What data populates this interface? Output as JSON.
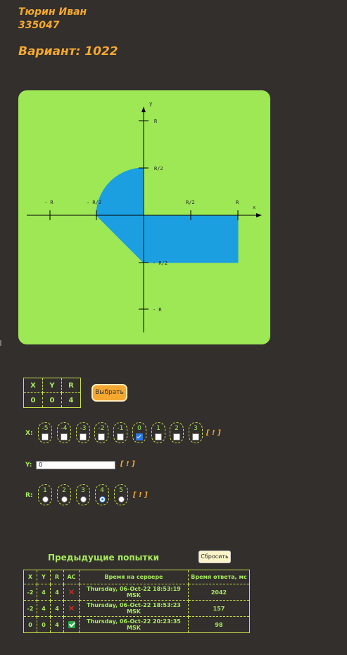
{
  "header": {
    "author": "Тюрин Иван",
    "group": "335047",
    "variant": "Вариант: 1022"
  },
  "graph": {
    "x_axis_label": "x",
    "y_axis_label": "y",
    "x_ticks": [
      "- R",
      "- R/2",
      "R/2",
      "R"
    ],
    "y_ticks": [
      "R",
      "R/2",
      "- R/2",
      "- R"
    ],
    "area_color": "#1b9fe0",
    "background_color": "#9ee755"
  },
  "current": {
    "headers": [
      "X",
      "Y",
      "R"
    ],
    "values": [
      "0",
      "0",
      "4"
    ]
  },
  "select_button": "Выбрать",
  "x_select": {
    "label": "X:",
    "options": [
      "-5",
      "-4",
      "-3",
      "-2",
      "-1",
      "0",
      "1",
      "2",
      "3"
    ],
    "checked": "0",
    "warning": "[ ! ]"
  },
  "y_input": {
    "label": "Y:",
    "value": "0",
    "warning": "[ ! ]"
  },
  "r_select": {
    "label": "R:",
    "options": [
      "1",
      "2",
      "3",
      "4",
      "5"
    ],
    "selected": "4",
    "warning": "[ ! ]"
  },
  "history": {
    "title": "Предыдущие попытки",
    "reset_button": "Сбросить",
    "headers": [
      "X",
      "Y",
      "R",
      "AC",
      "Время на сервере",
      "Время ответа, мс"
    ],
    "rows": [
      {
        "x": "-2",
        "y": "4",
        "r": "4",
        "hit": false,
        "time": "Thursday, 06-Oct-22 18:53:19 MSK",
        "ms": "2042"
      },
      {
        "x": "-2",
        "y": "4",
        "r": "4",
        "hit": false,
        "time": "Thursday, 06-Oct-22 18:53:23 MSK",
        "ms": "157"
      },
      {
        "x": "0",
        "y": "0",
        "r": "4",
        "hit": true,
        "time": "Thursday, 06-Oct-22 20:23:35 MSK",
        "ms": "98"
      }
    ]
  }
}
